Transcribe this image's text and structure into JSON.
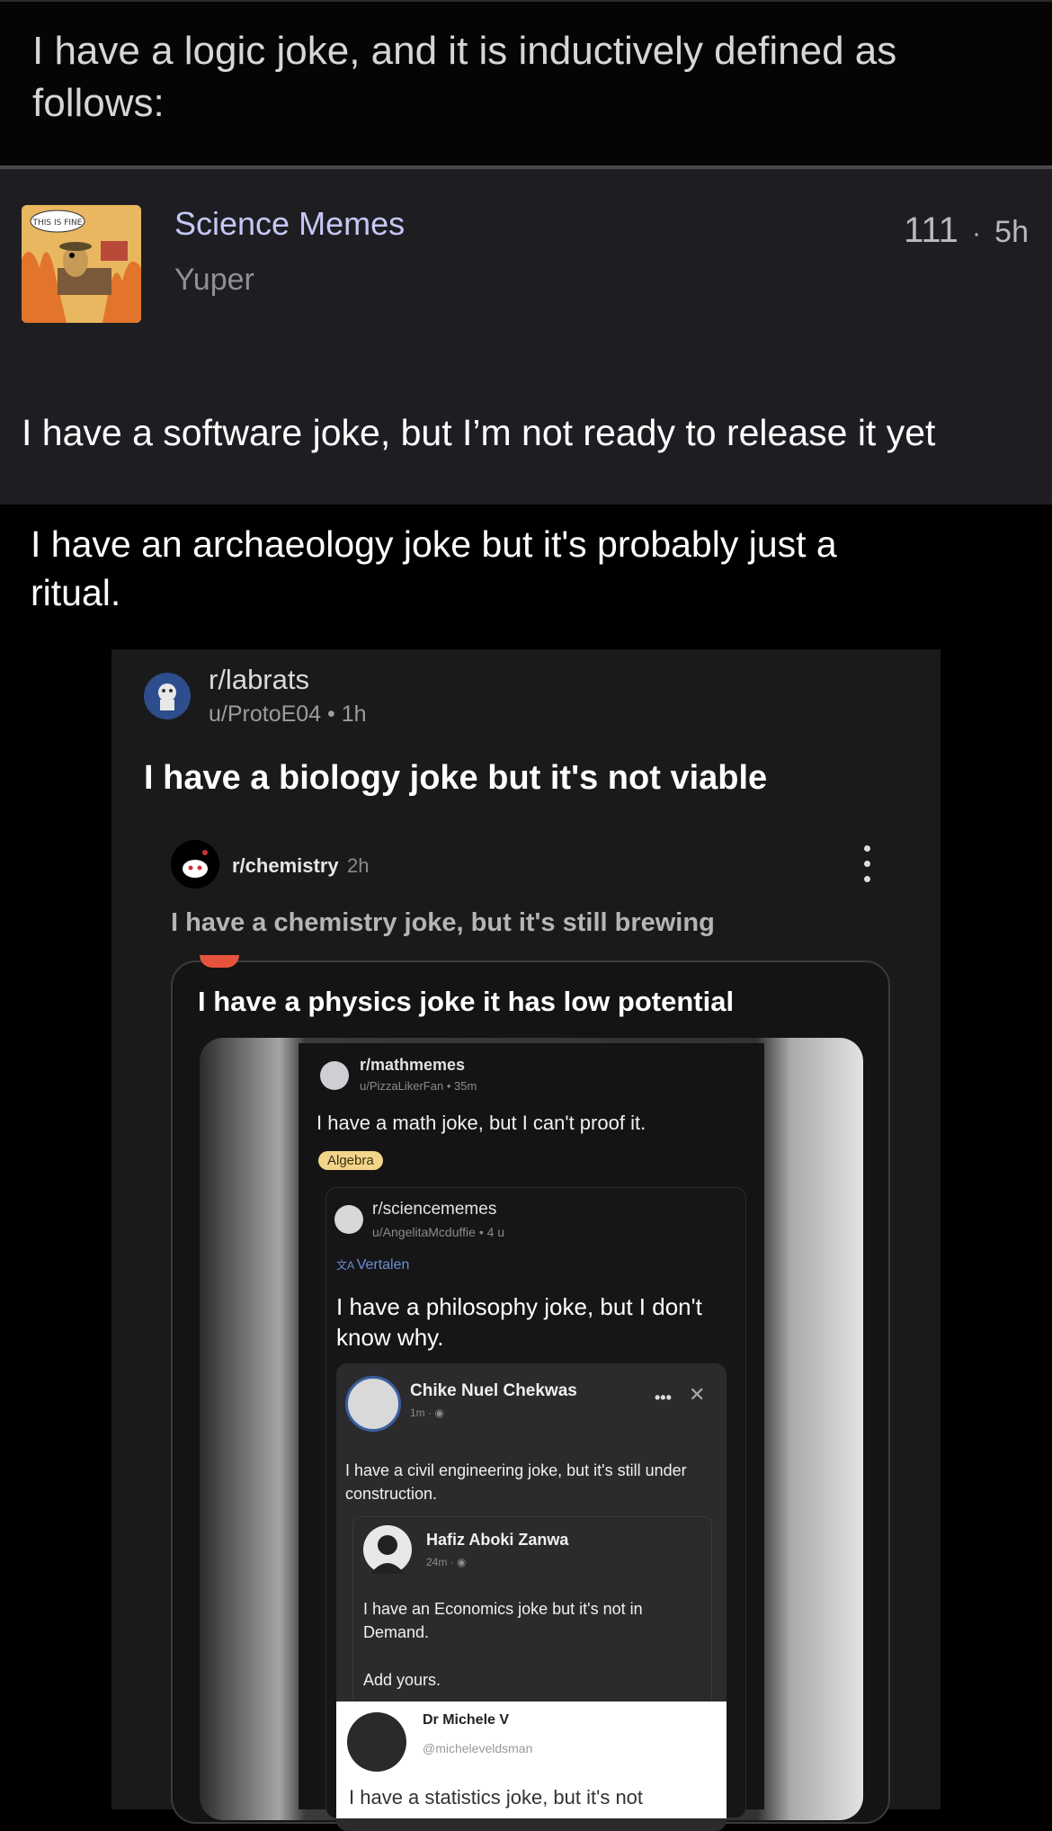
{
  "post": {
    "title": "I have a logic joke, and it is inductively defined as follows:"
  },
  "comment": {
    "community": "Science Memes",
    "author": "Yuper",
    "score": "111",
    "age": "5h",
    "meta_separator": "·",
    "text": "I have a software joke, but I’m not ready to release it yet",
    "thumbnail_caption": "THIS IS FINE"
  },
  "quote": {
    "text": "I have an archaeology joke but it's probably just a ritual."
  },
  "labrats": {
    "subreddit": "r/labrats",
    "user": "u/ProtoE04 • 1h",
    "title": "I have a biology joke but it's not viable"
  },
  "chemistry": {
    "subreddit": "r/chemistry",
    "time": "2h",
    "text": "I have a chemistry joke, but it's still brewing"
  },
  "physics": {
    "title": "I have a physics joke it has low potential"
  },
  "math": {
    "subreddit": "r/mathmemes",
    "user": "u/PizzaLikerFan • 35m",
    "text": "I have a math joke, but I can't proof it.",
    "flair": "Algebra"
  },
  "sciencememes": {
    "subreddit": "r/sciencememes",
    "user": "u/AngelitaMcduffie • 4 u",
    "translate": "Vertalen",
    "text": "I have a philosophy joke, but I don't know why."
  },
  "facebook": {
    "name": "Chike Nuel Chekwas",
    "time": "1m · ◉",
    "dots": "•••",
    "close": "✕",
    "text": "I have a civil engineering joke, but it's still under construction."
  },
  "hafiz": {
    "name": "Hafiz Aboki Zanwa",
    "time": "24m · ◉",
    "text": "I have an Economics joke but it's not in Demand.",
    "add_yours": "Add yours."
  },
  "tweet": {
    "name": "Dr Michele V",
    "handle": "@micheleveldsman",
    "text": "I have a statistics joke, but it's not"
  },
  "icons": {
    "translate_icon": "translate-icon",
    "kebab_icon": "more-vertical-icon"
  },
  "colors": {
    "community_link": "#c5c8f5",
    "card_bg": "#1e1e22",
    "flair_bg": "#f2d58a",
    "reddit_accent": "#e5533c"
  }
}
